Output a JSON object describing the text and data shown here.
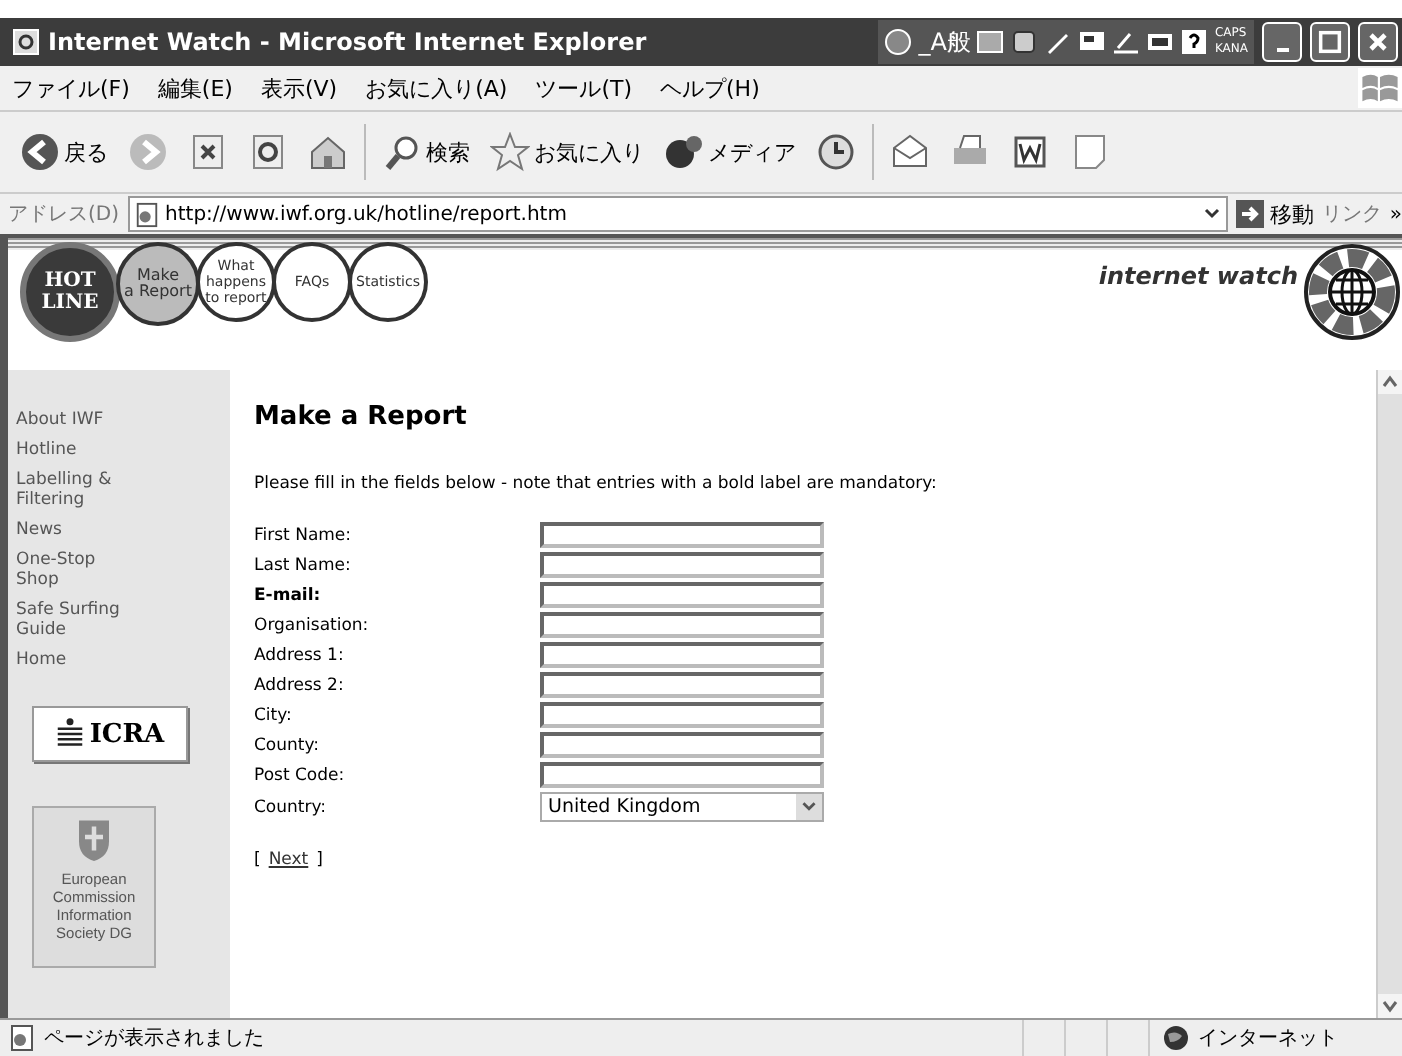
{
  "window": {
    "title": "Internet Watch - Microsoft Internet Explorer",
    "ime": {
      "caps": "CAPS",
      "kana": "KANA",
      "mode": "_A般"
    }
  },
  "menu": [
    "ファイル(F)",
    "編集(E)",
    "表示(V)",
    "お気に入り(A)",
    "ツール(T)",
    "ヘルプ(H)"
  ],
  "toolbar": [
    {
      "kind": "back",
      "label": "戻る"
    },
    {
      "kind": "forward"
    },
    {
      "kind": "stop"
    },
    {
      "kind": "refresh"
    },
    {
      "kind": "home"
    },
    {
      "kind": "search",
      "label": "検索"
    },
    {
      "kind": "favorites",
      "label": "お気に入り"
    },
    {
      "kind": "media",
      "label": "メディア"
    },
    {
      "kind": "history"
    },
    {
      "kind": "mail"
    },
    {
      "kind": "print"
    },
    {
      "kind": "edit"
    },
    {
      "kind": "note"
    }
  ],
  "address": {
    "label": "アドレス(D)",
    "url": "http://www.iwf.org.uk/hotline/report.htm",
    "go": "移動",
    "links": "リンク",
    "more": "»"
  },
  "site": {
    "badge": [
      "HOT",
      "LINE"
    ],
    "nav": [
      {
        "lines": [
          "Make",
          "a Report"
        ],
        "selected": true
      },
      {
        "lines": [
          "What",
          "happens",
          "to report"
        ],
        "selected": false
      },
      {
        "lines": [
          "FAQs"
        ],
        "selected": false
      },
      {
        "lines": [
          "Statistics"
        ],
        "selected": false
      }
    ],
    "logo": "internet watch",
    "sidebar": [
      "About IWF",
      "Hotline",
      "Labelling & Filtering",
      "News",
      "One-Stop Shop",
      "Safe Surfing Guide",
      "Home"
    ],
    "icra": "ICRA",
    "ec": "European Commission Information Society DG"
  },
  "form": {
    "heading": "Make a Report",
    "intro": "Please fill in the fields below - note that entries with a bold label are mandatory:",
    "fields": [
      {
        "label": "First Name:",
        "kind": "text",
        "mandatory": false
      },
      {
        "label": "Last Name:",
        "kind": "text",
        "mandatory": false
      },
      {
        "label": "E-mail:",
        "kind": "text",
        "mandatory": true
      },
      {
        "label": "Organisation:",
        "kind": "text",
        "mandatory": false
      },
      {
        "label": "Address 1:",
        "kind": "text",
        "mandatory": false
      },
      {
        "label": "Address 2:",
        "kind": "text",
        "mandatory": false
      },
      {
        "label": "City:",
        "kind": "text",
        "mandatory": false
      },
      {
        "label": "County:",
        "kind": "text",
        "mandatory": false
      },
      {
        "label": "Post Code:",
        "kind": "text",
        "mandatory": false
      },
      {
        "label": "Country:",
        "kind": "select",
        "value": "United Kingdom",
        "mandatory": false
      }
    ],
    "next": {
      "open": "[",
      "link": "Next",
      "close": "]"
    }
  },
  "status_bar": {
    "text": "ページが表示されました",
    "zone": "インターネット"
  }
}
